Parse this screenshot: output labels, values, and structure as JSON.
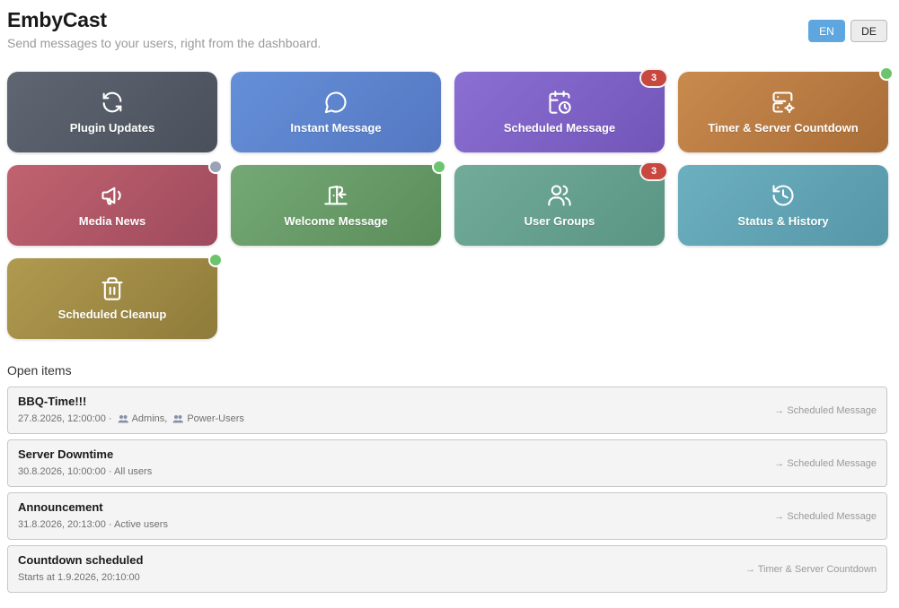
{
  "app": {
    "title": "EmbyCast",
    "subtitle": "Send messages to your users, right from the dashboard."
  },
  "languages": [
    {
      "label": "EN",
      "active": true
    },
    {
      "label": "DE",
      "active": false
    }
  ],
  "tiles": [
    {
      "label": "Plugin Updates",
      "icon": "refresh-icon",
      "color": "#555c67"
    },
    {
      "label": "Instant Message",
      "icon": "chat-bubble-icon",
      "color": "#5d84cf"
    },
    {
      "label": "Scheduled Message",
      "icon": "calendar-clock-icon",
      "color": "#7f62c5",
      "badge": "3"
    },
    {
      "label": "Timer & Server Countdown",
      "icon": "server-gear-icon",
      "color": "#b97c43",
      "status_dot": "#6cc46c"
    },
    {
      "label": "Media News",
      "icon": "megaphone-icon",
      "color": "#b05768",
      "status_dot": "#9aa2b3"
    },
    {
      "label": "Welcome Message",
      "icon": "door-enter-icon",
      "color": "#679b67",
      "status_dot": "#6cc46c"
    },
    {
      "label": "User Groups",
      "icon": "users-icon",
      "color": "#66a08e",
      "badge": "3"
    },
    {
      "label": "Status & History",
      "icon": "history-icon",
      "color": "#61a3b4"
    },
    {
      "label": "Scheduled Cleanup",
      "icon": "trash-icon",
      "color": "#9f8a45",
      "status_dot": "#6cc46c"
    }
  ],
  "open_items": {
    "heading": "Open items",
    "items": [
      {
        "title": "BBQ-Time!!!",
        "meta": "27.8.2026, 12:00:00 ·",
        "groups": [
          "Admins,",
          "Power-Users"
        ],
        "target": "→ Scheduled Message"
      },
      {
        "title": "Server Downtime",
        "meta": "30.8.2026, 10:00:00 · All users",
        "groups": [],
        "target": "→ Scheduled Message"
      },
      {
        "title": "Announcement",
        "meta": "31.8.2026, 20:13:00 · Active users",
        "groups": [],
        "target": "→ Scheduled Message"
      },
      {
        "title": "Countdown scheduled",
        "meta": "Starts at 1.9.2026, 20:10:00",
        "groups": [],
        "target": "→ Timer & Server Countdown"
      }
    ]
  }
}
